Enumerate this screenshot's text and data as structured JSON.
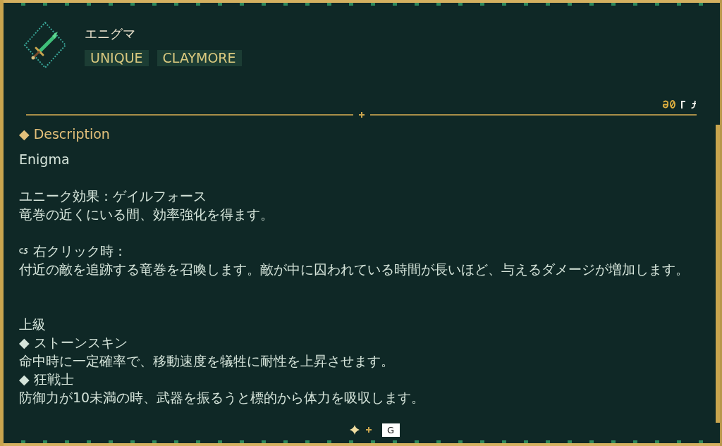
{
  "item": {
    "name": "エニグマ",
    "tags": [
      "UNIQUE",
      "CLAYMORE"
    ]
  },
  "description": {
    "heading": "◆ Description",
    "blocks": [
      {
        "kind": "plain",
        "lines": [
          "Enigma"
        ]
      },
      {
        "kind": "plain",
        "lines": [
          "ユニーク効果：ゲイルフォース",
          "竜巻の近くにいる間、効率強化を得ます。"
        ]
      },
      {
        "kind": "ability",
        "trigger": "右クリック時：",
        "lines": [
          "付近の敵を追跡する竜巻を召喚します。敵が中に囚われている時間が長いほど、与えるダメージが増加します。"
        ]
      },
      {
        "kind": "upgrades",
        "title": "上級",
        "perks": [
          {
            "name": "◆ ストーンスキン",
            "effect": "命中時に一定確率で、移動速度を犠牲に耐性を上昇させます。"
          },
          {
            "name": "◆ 狂戦士",
            "effect": "防御力が10未満の時、武器を振るうと標的から体力を吸収します。"
          }
        ]
      }
    ]
  },
  "footer": {
    "key_hint": "G"
  }
}
